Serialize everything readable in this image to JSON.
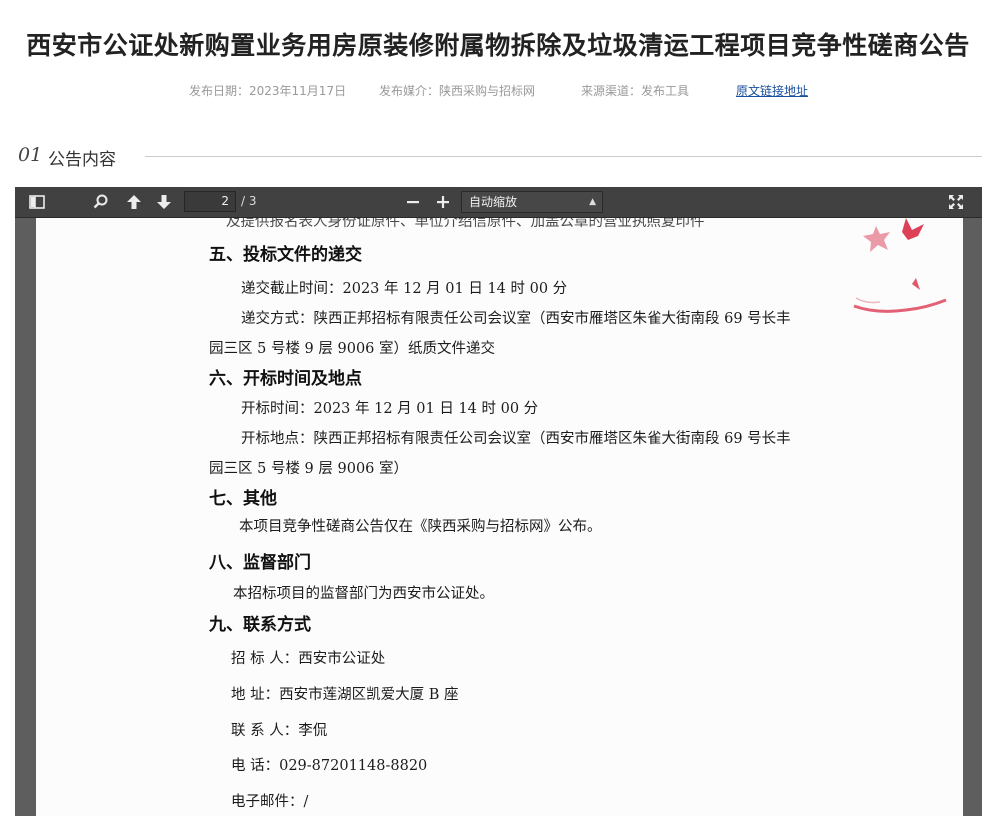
{
  "article": {
    "title": "西安市公证处新购置业务用房原装修附属物拆除及垃圾清运工程项目竞争性磋商公告",
    "publish_date": "发布日期：2023年11月17日",
    "media": "发布媒介：陕西采购与招标网",
    "source": "来源渠道：发布工具",
    "original_link": "原文链接地址"
  },
  "section": {
    "number": "01",
    "label": "公告内容"
  },
  "viewer": {
    "current_page": "2",
    "page_total": "/ 3",
    "zoom": "自动缩放",
    "icons": {
      "sidebar": "sidebar-toggle-icon",
      "search": "search-icon",
      "prev": "arrow-up-icon",
      "next": "arrow-down-icon",
      "zoom_out": "minus-icon",
      "zoom_in": "plus-icon",
      "fullscreen": "fullscreen-icon"
    }
  },
  "document": {
    "partial_top_line": "及提供报名表人身份证原件、单位介绍信原件、加盖公章的营业执照复印件",
    "h5": "五、投标文件的递交",
    "h5_line1": "递交截止时间：2023 年 12 月 01 日  14 时 00 分",
    "h5_line2": "递交方式：陕西正邦招标有限责任公司会议室（西安市雁塔区朱雀大街南段 69 号长丰",
    "h5_line3": "园三区 5 号楼 9 层 9006 室）纸质文件递交",
    "h6": "六、开标时间及地点",
    "h6_line1": "开标时间：2023 年 12 月 01 日  14 时 00 分",
    "h6_line2": "开标地点：陕西正邦招标有限责任公司会议室（西安市雁塔区朱雀大街南段 69 号长丰",
    "h6_line3": "园三区 5 号楼 9 层 9006 室）",
    "h7": "七、其他",
    "h7_line1": "本项目竞争性磋商公告仅在《陕西采购与招标网》公布。",
    "h8": "八、监督部门",
    "h8_line1": "本招标项目的监督部门为西安市公证处。",
    "h9": "九、联系方式",
    "contact_tenderer": "招 标 人：西安市公证处",
    "contact_address": "地      址：西安市莲湖区凯爱大厦 B 座",
    "contact_person": "联 系 人：李侃",
    "contact_phone": "电      话：029-87201148-8820",
    "contact_email": "电子邮件：/"
  },
  "colors": {
    "link": "#1a4f9c",
    "toolbar": "#414141",
    "viewer_bg": "#5e5e5e",
    "stamp": "#d8203a"
  }
}
